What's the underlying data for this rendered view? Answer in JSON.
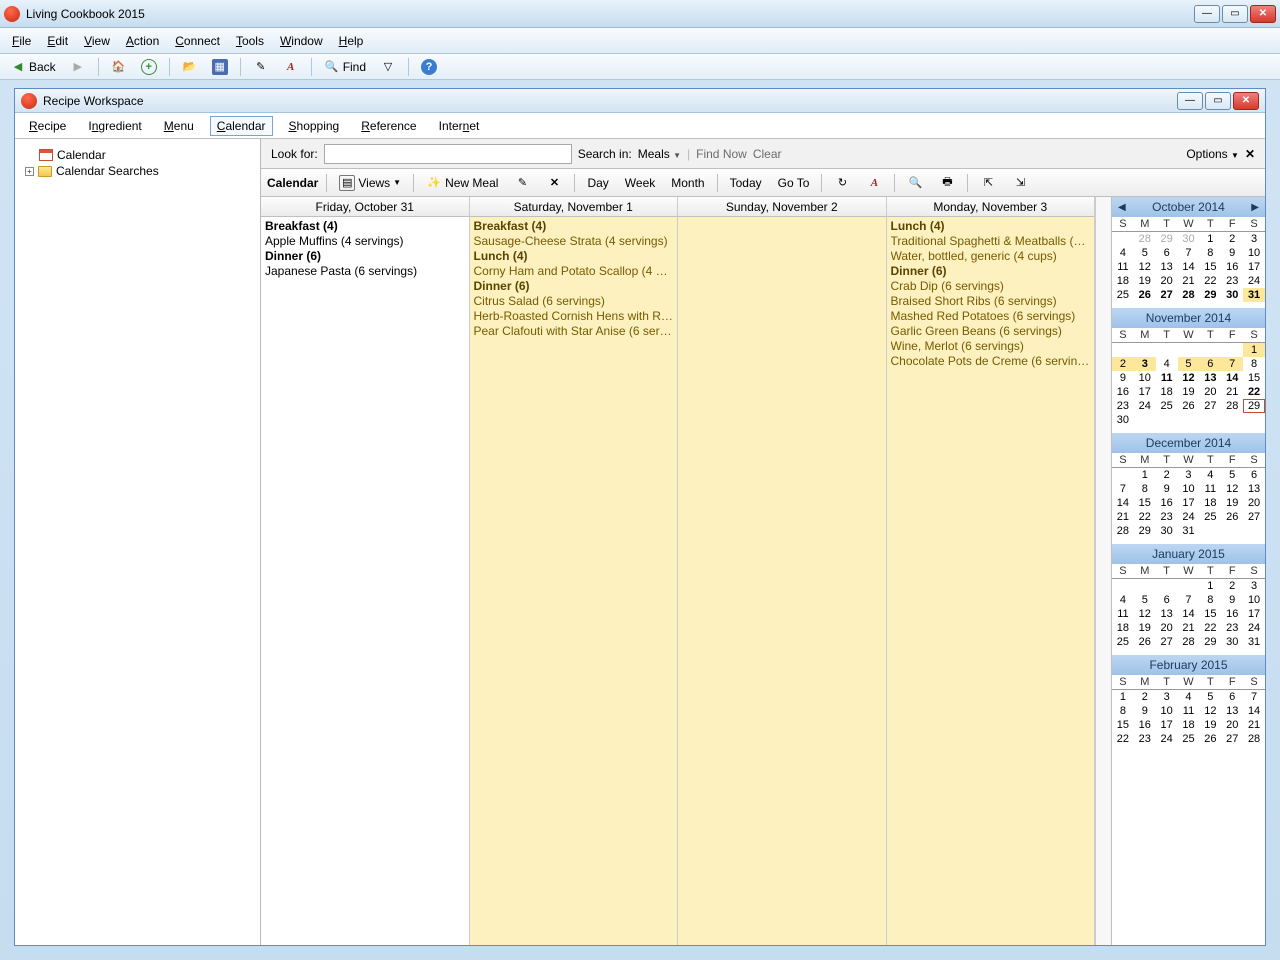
{
  "title": "Living Cookbook 2015",
  "menubar": [
    "File",
    "Edit",
    "View",
    "Action",
    "Connect",
    "Tools",
    "Window",
    "Help"
  ],
  "toolbar": {
    "back": "Back",
    "find": "Find"
  },
  "workspace": {
    "title": "Recipe Workspace",
    "tabs": [
      "Recipe",
      "Ingredient",
      "Menu",
      "Calendar",
      "Shopping",
      "Reference",
      "Internet"
    ],
    "active_tab": 3,
    "tree": {
      "root": "Calendar",
      "child": "Calendar Searches"
    }
  },
  "search": {
    "look_for": "Look for:",
    "search_in": "Search in:",
    "dropdown": "Meals",
    "find_now": "Find Now",
    "clear": "Clear",
    "options": "Options"
  },
  "calbar": {
    "label": "Calendar",
    "views": "Views",
    "new_meal": "New Meal",
    "day": "Day",
    "week": "Week",
    "month": "Month",
    "today": "Today",
    "goto": "Go To"
  },
  "days": [
    {
      "title": "Friday, October 31",
      "bg": "",
      "groups": [
        {
          "hdr": "Breakfast (4)",
          "items": [
            "Apple Muffins (4 servings)"
          ]
        },
        {
          "hdr": "Dinner (6)",
          "items": [
            "Japanese Pasta (6 servings)"
          ]
        }
      ]
    },
    {
      "title": "Saturday, November 1",
      "bg": "y",
      "groups": [
        {
          "hdr": "Breakfast (4)",
          "items": [
            "Sausage-Cheese Strata (4 servings)"
          ]
        },
        {
          "hdr": "Lunch (4)",
          "items": [
            "Corny Ham and Potato Scallop (4 ser..."
          ]
        },
        {
          "hdr": "Dinner (6)",
          "items": [
            "Citrus Salad (6 servings)",
            "Herb-Roasted Cornish Hens with Roo...",
            "Pear Clafouti with Star Anise (6 servi..."
          ]
        }
      ]
    },
    {
      "title": "Sunday, November 2",
      "bg": "y",
      "groups": []
    },
    {
      "title": "Monday, November 3",
      "bg": "y",
      "groups": [
        {
          "hdr": "Lunch (4)",
          "items": [
            "Traditional Spaghetti & Meatballs (4 s...",
            "Water, bottled, generic (4 cups)"
          ]
        },
        {
          "hdr": "Dinner (6)",
          "items": [
            "Crab Dip (6 servings)",
            "Braised Short Ribs (6 servings)",
            "Mashed Red Potatoes (6 servings)",
            "Garlic Green Beans (6 servings)",
            "Wine, Merlot (6 servings)",
            "Chocolate Pots de Creme (6 servings)"
          ]
        }
      ]
    }
  ],
  "dow": [
    "S",
    "M",
    "T",
    "W",
    "T",
    "F",
    "S"
  ],
  "months": [
    {
      "title": "October 2014",
      "nav": true,
      "lead": 4,
      "prev_tail": [
        28,
        29,
        30
      ],
      "days": 31,
      "bold": [
        26,
        27,
        28,
        29,
        30,
        31
      ],
      "hl": [
        31
      ],
      "today": null
    },
    {
      "title": "November 2014",
      "lead": 6,
      "prev_tail": [],
      "days": 30,
      "bold": [
        3,
        11,
        12,
        13,
        14,
        22
      ],
      "hl": [
        1,
        2,
        3,
        5,
        6,
        7
      ],
      "today": 29
    },
    {
      "title": "December 2014",
      "lead": 1,
      "prev_tail": [],
      "days": 31,
      "bold": [],
      "hl": [],
      "today": null
    },
    {
      "title": "January 2015",
      "lead": 4,
      "prev_tail": [],
      "days": 31,
      "bold": [],
      "hl": [],
      "today": null
    },
    {
      "title": "February 2015",
      "lead": 0,
      "prev_tail": [],
      "days": 28,
      "bold": [],
      "hl": [],
      "today": null
    }
  ]
}
